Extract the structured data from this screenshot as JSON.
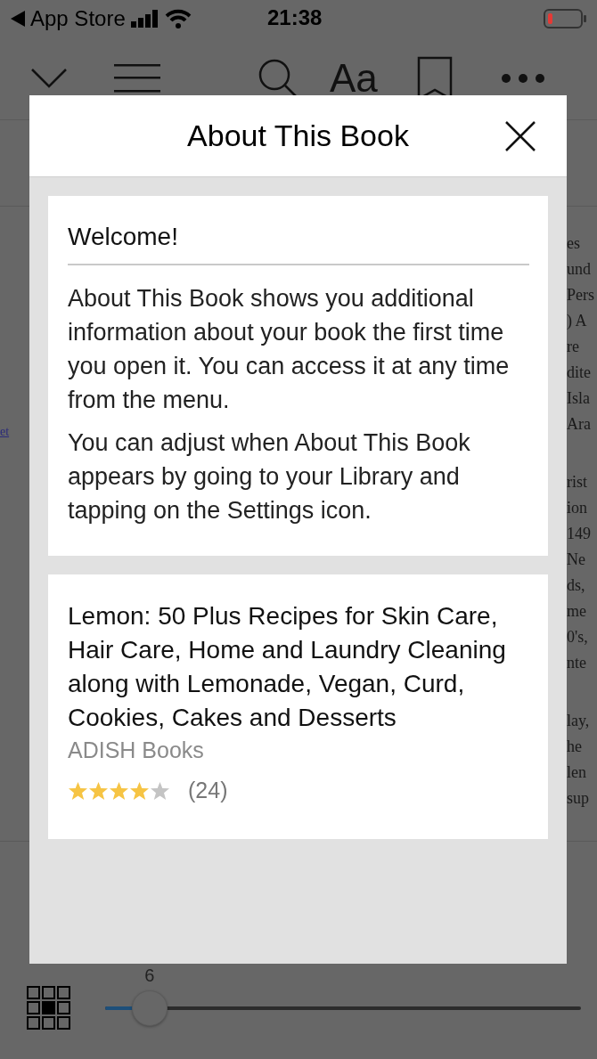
{
  "status_bar": {
    "back_label": "App Store",
    "time": "21:38"
  },
  "toolbar": {
    "font_button_label": "Aa"
  },
  "reader": {
    "link_text": "et",
    "right_column_paragraphs": [
      [
        "es",
        "und",
        "Pers",
        ") A",
        "re",
        "dite",
        "Isla",
        "Ara"
      ],
      [
        "rist",
        "ion",
        "149",
        "Ne",
        "ds,",
        "me",
        "0's,",
        "nte"
      ],
      [
        "lay,",
        "he",
        "len",
        "sup"
      ]
    ]
  },
  "dialog": {
    "title": "About This Book",
    "welcome": {
      "heading": "Welcome!",
      "paragraphs": [
        "About This Book shows you additional information about your book the first time you open it. You can access it at any time from the menu.",
        "You can adjust when About This Book appears by going to your Library and tapping on the Settings icon."
      ]
    },
    "book": {
      "title": "Lemon: 50 Plus Recipes for Skin Care, Hair Care, Home and Laundry Cleaning along with Lemonade, Vegan, Curd, Cookies, Cakes and Desserts",
      "publisher": "ADISH Books",
      "stars": 4,
      "rating_count": "(24)"
    }
  },
  "page_slider": {
    "page_label": "6",
    "level": 0.094
  }
}
